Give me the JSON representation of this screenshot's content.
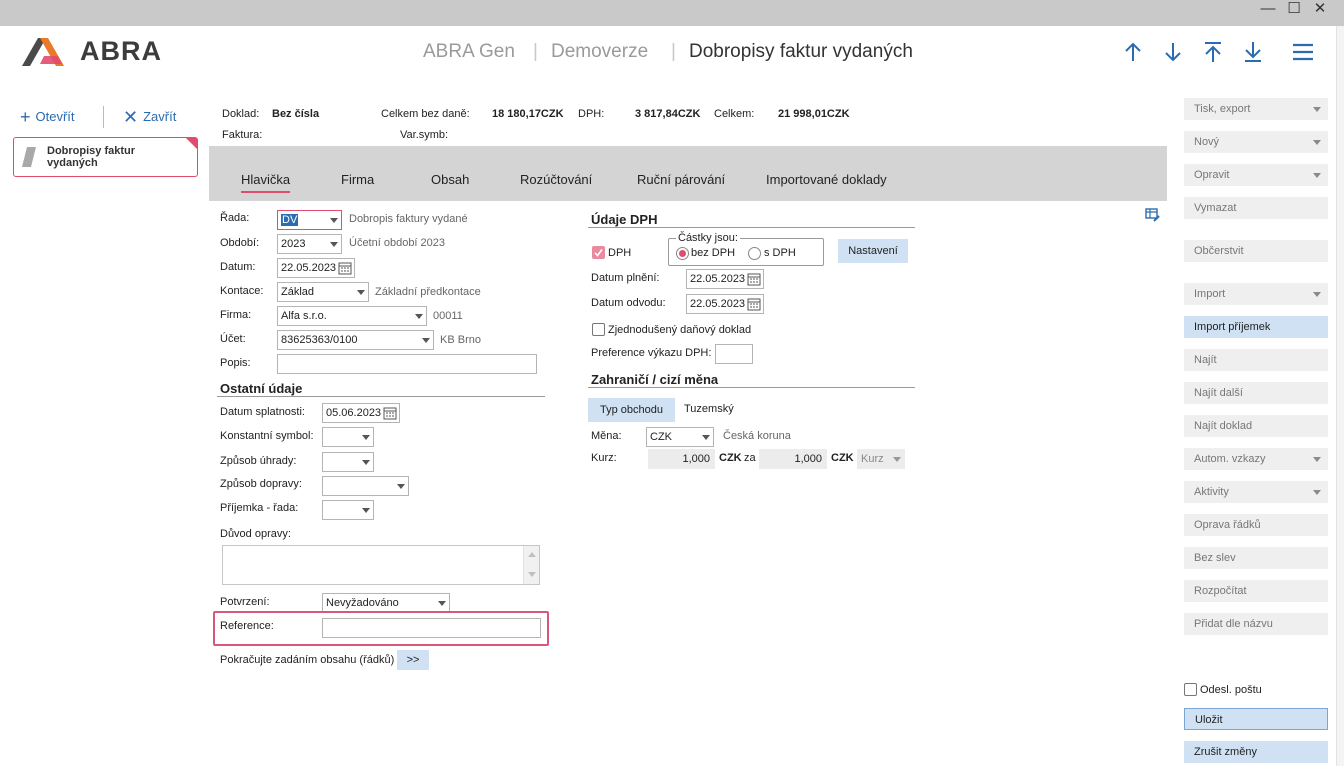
{
  "window": {
    "minimize_glyph": "—",
    "maximize_glyph": "☐",
    "close_glyph": "✕"
  },
  "header": {
    "logo_text": "ABRA",
    "app_name": "ABRA Gen",
    "sep": "|",
    "edition": "Demoverze",
    "title": "Dobropisy faktur vydaných",
    "nav_icons": [
      "arrow-up-icon",
      "arrow-down-icon",
      "arrow-first-icon",
      "arrow-last-icon",
      "hamburger-menu-icon"
    ]
  },
  "left": {
    "open_label": "Otevřít",
    "close_label": "Zavřít",
    "doc_card_label": "Dobropisy faktur vydaných"
  },
  "summary": {
    "doklad_label": "Doklad:",
    "doklad_value": "Bez čísla",
    "bez_dane_label": "Celkem bez daně:",
    "bez_dane_value": "18 180,17CZK",
    "dph_label": "DPH:",
    "dph_value": "3 817,84CZK",
    "celkem_label": "Celkem:",
    "celkem_value": "21 998,01CZK",
    "faktura_label": "Faktura:",
    "varsymb_label": "Var.symb:"
  },
  "tabs": [
    {
      "label": "Hlavička",
      "active": true
    },
    {
      "label": "Firma"
    },
    {
      "label": "Obsah"
    },
    {
      "label": "Rozúčtování"
    },
    {
      "label": "Ruční párování"
    },
    {
      "label": "Importované doklady"
    }
  ],
  "form": {
    "rada_label": "Řada:",
    "rada_value": "DV",
    "rada_hint": "Dobropis faktury vydané",
    "obdobi_label": "Období:",
    "obdobi_value": "2023",
    "obdobi_hint": "Účetní období 2023",
    "datum_label": "Datum:",
    "datum_value": "22.05.2023",
    "kontace_label": "Kontace:",
    "kontace_value": "Základ",
    "kontace_hint": "Základní předkontace",
    "firma_label": "Firma:",
    "firma_value": "Alfa s.r.o.",
    "firma_hint": "00011",
    "ucet_label": "Účet:",
    "ucet_value": "83625363/0100",
    "ucet_hint": "KB Brno",
    "popis_label": "Popis:",
    "popis_value": "",
    "ostatni_title": "Ostatní údaje",
    "splatnost_label": "Datum splatnosti:",
    "splatnost_value": "05.06.2023",
    "konst_label": "Konstantní symbol:",
    "uhrada_label": "Způsob úhrady:",
    "doprava_label": "Způsob dopravy:",
    "prijemka_label": "Příjemka - řada:",
    "duvod_label": "Důvod opravy:",
    "potvrzeni_label": "Potvrzení:",
    "potvrzeni_value": "Nevyžadováno",
    "reference_label": "Reference:",
    "reference_value": "",
    "continue_label": "Pokračujte zadáním obsahu (řádků)",
    "continue_btn": ">>"
  },
  "dph": {
    "title": "Údaje DPH",
    "dph_check_label": "DPH",
    "castky_label": "Částky jsou:",
    "bez_dph_label": "bez DPH",
    "s_dph_label": "s DPH",
    "nastaveni_label": "Nastavení",
    "plneni_label": "Datum plnění:",
    "plneni_value": "22.05.2023",
    "odvodu_label": "Datum odvodu:",
    "odvodu_value": "22.05.2023",
    "zjednoduseny_label": "Zjednodušený daňový doklad",
    "preference_label": "Preference výkazu DPH:"
  },
  "foreign": {
    "title": "Zahraničí /  cizí měna",
    "typ_btn": "Typ obchodu",
    "typ_value": "Tuzemský",
    "mena_label": "Měna:",
    "mena_value": "CZK",
    "mena_hint": "Česká koruna",
    "kurz_label": "Kurz:",
    "kurz_value1": "1,000",
    "kurz_cur1": "CZK",
    "kurz_za": "za",
    "kurz_value2": "1,000",
    "kurz_cur2": "CZK",
    "kurz_dd": "Kurz"
  },
  "sidebar": {
    "buttons": [
      {
        "label": "Tisk, export",
        "dropdown": true,
        "enabled": false
      },
      {
        "label": "Nový",
        "dropdown": true,
        "enabled": false
      },
      {
        "label": "Opravit",
        "dropdown": true,
        "enabled": false
      },
      {
        "label": "Vymazat",
        "enabled": false
      },
      {
        "label": "Občerstvit",
        "enabled": false
      },
      {
        "label": "Import",
        "dropdown": true,
        "enabled": false
      },
      {
        "label": "Import příjemek",
        "enabled": true
      },
      {
        "label": "Najít",
        "enabled": false
      },
      {
        "label": "Najít další",
        "enabled": false
      },
      {
        "label": "Najít doklad",
        "enabled": false
      },
      {
        "label": "Autom. vzkazy",
        "dropdown": true,
        "enabled": false
      },
      {
        "label": "Aktivity",
        "dropdown": true,
        "enabled": false
      },
      {
        "label": "Oprava řádků",
        "enabled": false
      },
      {
        "label": "Bez slev",
        "enabled": false
      },
      {
        "label": "Rozpočítat",
        "enabled": false
      },
      {
        "label": "Přidat dle názvu",
        "enabled": false
      }
    ],
    "odesl_label": "Odesl. poštu",
    "ulozit_label": "Uložit",
    "zrusit_label": "Zrušit změny"
  },
  "colors": {
    "accent": "#e14b6c",
    "blue": "#2b6cb0",
    "button_blue": "#cfe1f3"
  }
}
